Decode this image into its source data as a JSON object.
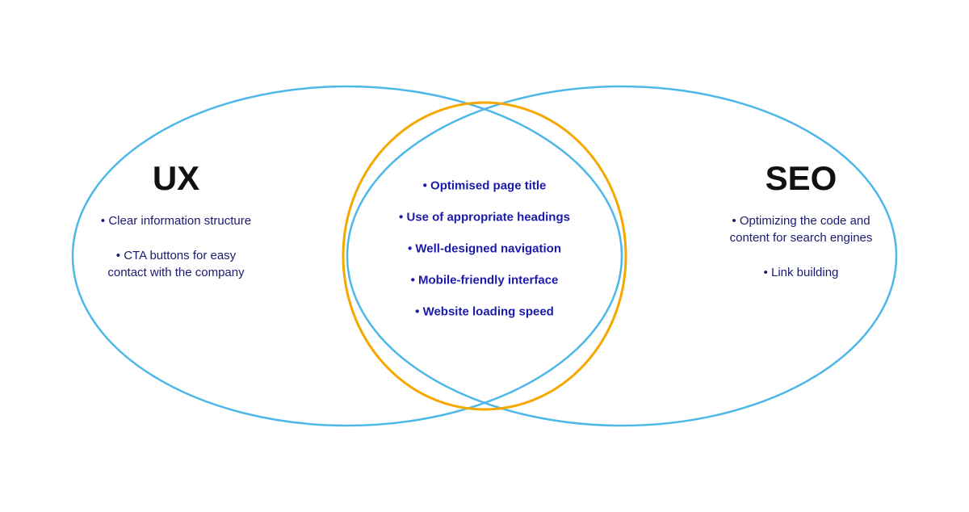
{
  "diagram": {
    "ux": {
      "title": "UX",
      "items": [
        "Clear information structure",
        "CTA buttons for easy contact with the company"
      ]
    },
    "seo": {
      "title": "SEO",
      "items": [
        "Optimizing the code and content for search engines",
        "Link building"
      ]
    },
    "center": {
      "items": [
        "Optimised page title",
        "Use of appropriate headings",
        "Well-designed navigation",
        "Mobile-friendly interface",
        "Website loading speed"
      ]
    }
  },
  "colors": {
    "ux_circle": "#4db8e8",
    "seo_circle": "#4db8e8",
    "center_circle": "#f5a800",
    "text_dark": "#111111",
    "text_blue": "#1a1aaa"
  }
}
